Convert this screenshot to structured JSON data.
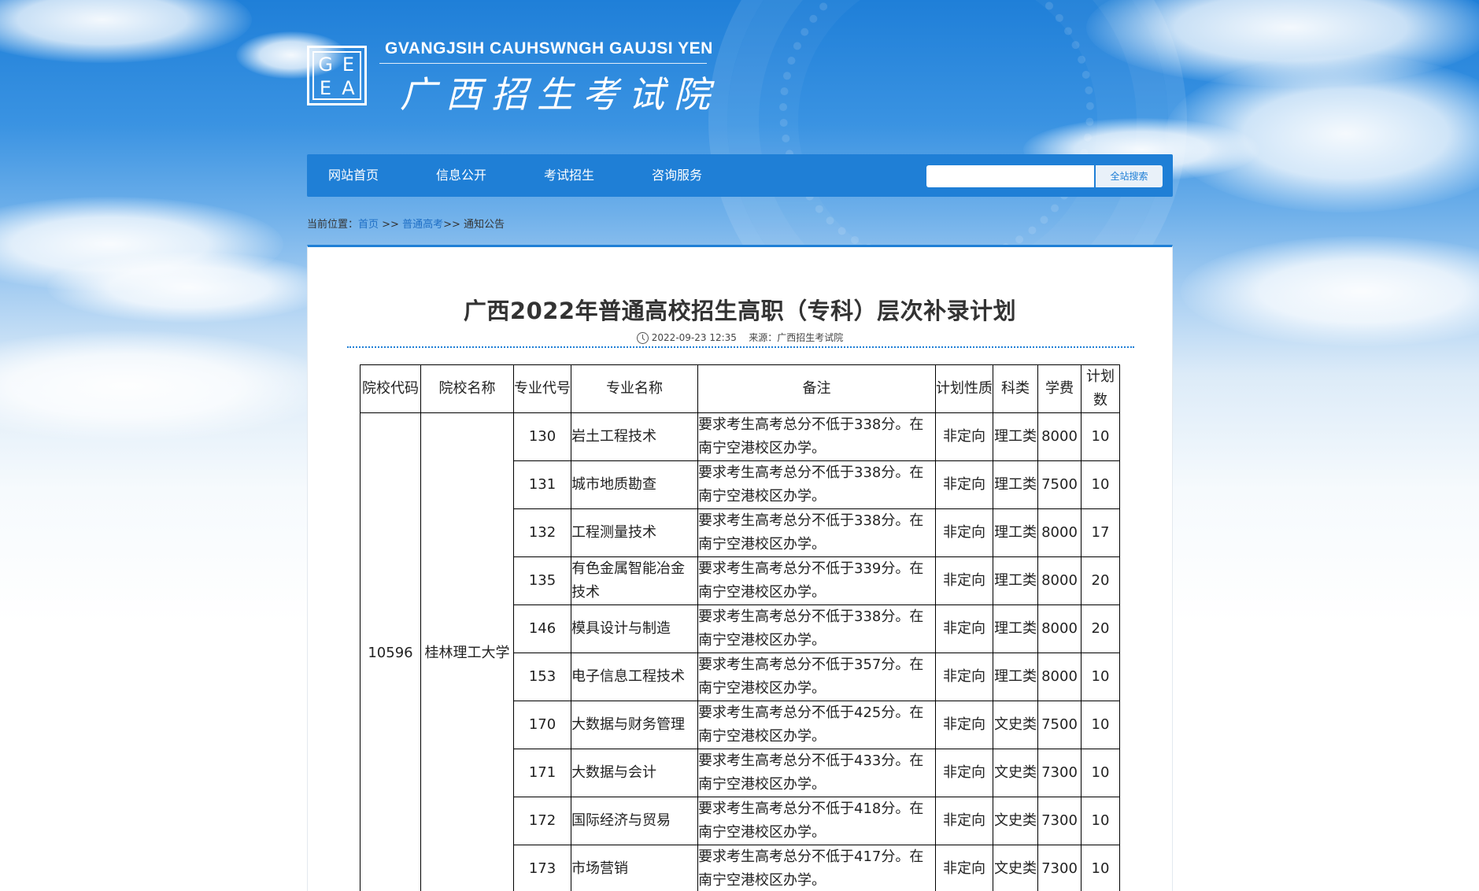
{
  "header": {
    "logo_letters": [
      "G",
      "E",
      "E",
      "A"
    ],
    "site_name_en": "GVANGJSIH CAUHSWNGH GAUJSI YEN",
    "site_name_cn": "广西招生考试院"
  },
  "nav": {
    "items": [
      {
        "label": "网站首页"
      },
      {
        "label": "信息公开"
      },
      {
        "label": "考试招生"
      },
      {
        "label": "咨询服务"
      }
    ],
    "search": {
      "value": "",
      "placeholder": "",
      "button_label": "全站搜索"
    }
  },
  "breadcrumb": {
    "prefix": "当前位置：",
    "home": "首页",
    "sep1": " >> ",
    "section": "普通高考",
    "sep2": ">> ",
    "current": "通知公告"
  },
  "article": {
    "title": "广西2022年普通高校招生高职（专科）层次补录计划",
    "date": "2022-09-23 12:35",
    "source": "来源：广西招生考试院"
  },
  "table": {
    "headers": [
      "院校代码",
      "院校名称",
      "专业代号",
      "专业名称",
      "备注",
      "计划性质",
      "科类",
      "学费",
      "计划数"
    ],
    "school_code": "10596",
    "school_name": "桂林理工大学",
    "rows": [
      {
        "code": "130",
        "name": "岩土工程技术",
        "note": "要求考生高考总分不低于338分。在南宁空港校区办学。",
        "nature": "非定向",
        "category": "理工类",
        "fee": "8000",
        "count": "10"
      },
      {
        "code": "131",
        "name": "城市地质勘查",
        "note": "要求考生高考总分不低于338分。在南宁空港校区办学。",
        "nature": "非定向",
        "category": "理工类",
        "fee": "7500",
        "count": "10"
      },
      {
        "code": "132",
        "name": "工程测量技术",
        "note": "要求考生高考总分不低于338分。在南宁空港校区办学。",
        "nature": "非定向",
        "category": "理工类",
        "fee": "8000",
        "count": "17"
      },
      {
        "code": "135",
        "name": "有色金属智能冶金技术",
        "note": "要求考生高考总分不低于339分。在南宁空港校区办学。",
        "nature": "非定向",
        "category": "理工类",
        "fee": "8000",
        "count": "20"
      },
      {
        "code": "146",
        "name": "模具设计与制造",
        "note": "要求考生高考总分不低于338分。在南宁空港校区办学。",
        "nature": "非定向",
        "category": "理工类",
        "fee": "8000",
        "count": "20"
      },
      {
        "code": "153",
        "name": "电子信息工程技术",
        "note": "要求考生高考总分不低于357分。在南宁空港校区办学。",
        "nature": "非定向",
        "category": "理工类",
        "fee": "8000",
        "count": "10"
      },
      {
        "code": "170",
        "name": "大数据与财务管理",
        "note": "要求考生高考总分不低于425分。在南宁空港校区办学。",
        "nature": "非定向",
        "category": "文史类",
        "fee": "7500",
        "count": "10"
      },
      {
        "code": "171",
        "name": "大数据与会计",
        "note": "要求考生高考总分不低于433分。在南宁空港校区办学。",
        "nature": "非定向",
        "category": "文史类",
        "fee": "7300",
        "count": "10"
      },
      {
        "code": "172",
        "name": "国际经济与贸易",
        "note": "要求考生高考总分不低于418分。在南宁空港校区办学。",
        "nature": "非定向",
        "category": "文史类",
        "fee": "7300",
        "count": "10"
      },
      {
        "code": "173",
        "name": "市场营销",
        "note": "要求考生高考总分不低于417分。在南宁空港校区办学。",
        "nature": "非定向",
        "category": "文史类",
        "fee": "7300",
        "count": "10"
      }
    ]
  }
}
